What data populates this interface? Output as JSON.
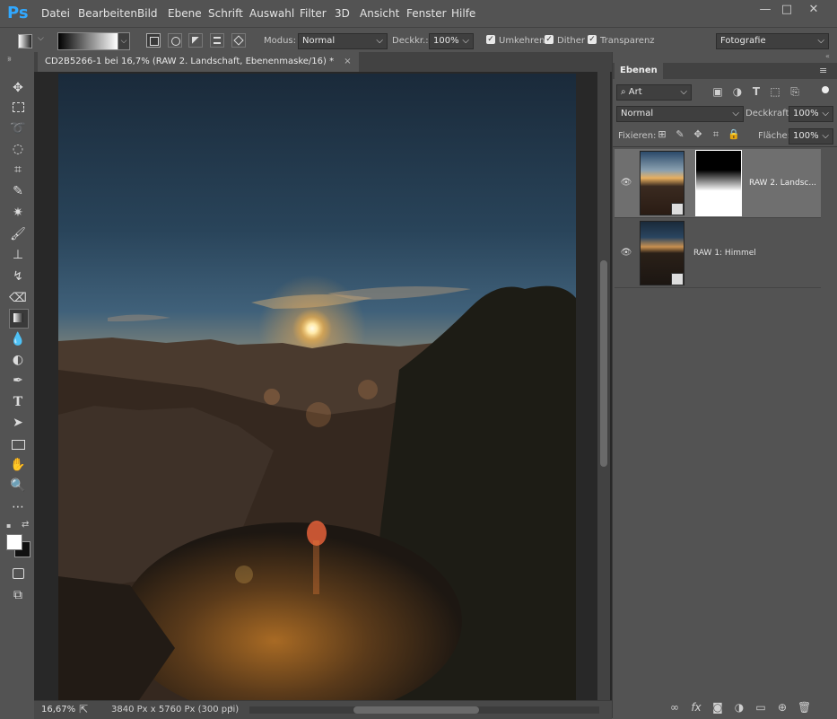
{
  "app": {
    "logo": "Ps"
  },
  "menu": [
    "Datei",
    "Bearbeiten",
    "Bild",
    "Ebene",
    "Schrift",
    "Auswahl",
    "Filter",
    "3D",
    "Ansicht",
    "Fenster",
    "Hilfe"
  ],
  "window_controls": {
    "minimize": "—",
    "restore": "□",
    "close": "✕"
  },
  "options": {
    "modus_label": "Modus:",
    "modus_value": "Normal",
    "deckkr_label": "Deckkr.:",
    "deckkr_value": "100%",
    "umkehren_label": "Umkehren",
    "dither_label": "Dither",
    "transparenz_label": "Transparenz",
    "workspace_value": "Fotografie"
  },
  "document": {
    "tab_title": "CD2B5266-1 bei 16,7% (RAW 2. Landschaft, Ebenenmaske/16) *",
    "tab_close": "×",
    "zoom": "16,67%",
    "size_info": "3840 Px x 5760 Px (300 ppi)"
  },
  "layers_panel": {
    "tab_label": "Ebenen",
    "filter_value": "Art",
    "blend_mode": "Normal",
    "opacity_label": "Deckkraft:",
    "opacity_value": "100%",
    "lock_label": "Fixieren:",
    "fill_label": "Fläche:",
    "fill_value": "100%",
    "layers": [
      {
        "name": "RAW 2. Landsc...",
        "selected": true
      },
      {
        "name": "RAW 1: Himmel",
        "selected": false
      }
    ]
  },
  "colors": {
    "accent": "#31a8ff",
    "panel": "#535353",
    "dark": "#424242",
    "canvas": "#282828"
  }
}
